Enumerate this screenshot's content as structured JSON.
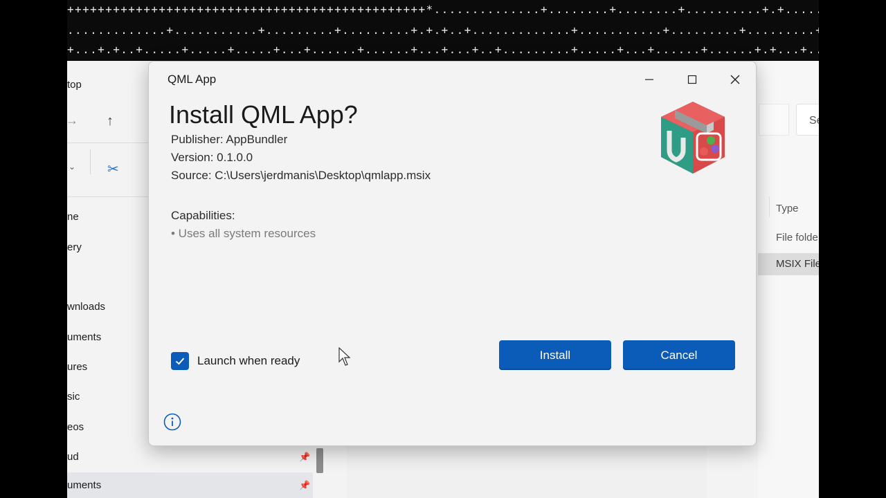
{
  "terminal": {
    "lines": [
      "+++++++++++++++++++++++++++++++++++++++++++++++*..............+........+........+..........+.+.......+.+.+..+",
      ".............+...........+.........+.........+.+.+..+.............+...........+.........+.........+...........",
      "+...+.+..+.....+.....+.....+...+......+......+...+...+..+.........+.....+...+......+......+.+...+.......+....+"
    ]
  },
  "explorer": {
    "title_fragment": "top",
    "search_fragment": "Se",
    "nav_items": [
      {
        "label": "ne",
        "pinned": false
      },
      {
        "label": "ery",
        "pinned": false
      },
      {
        "label": "wnloads",
        "pinned": false
      },
      {
        "label": "uments",
        "pinned": false
      },
      {
        "label": "ures",
        "pinned": false
      },
      {
        "label": "sic",
        "pinned": false
      },
      {
        "label": "eos",
        "pinned": false
      },
      {
        "label": "ud",
        "pinned": true
      },
      {
        "label": "uments",
        "pinned": true
      }
    ],
    "column_header": "Type",
    "rows": [
      "File folde",
      "MSIX File"
    ]
  },
  "dialog": {
    "window_title": "QML App",
    "heading": "Install QML App?",
    "publisher": "Publisher: AppBundler",
    "version": "Version: 0.1.0.0",
    "source": "Source: C:\\Users\\jerdmanis\\Desktop\\qmlapp.msix",
    "capabilities_label": "Capabilities:",
    "capabilities": [
      "• Uses all system resources"
    ],
    "launch_checkbox": {
      "label": "Launch when ready",
      "checked": true
    },
    "install_label": "Install",
    "cancel_label": "Cancel",
    "accent_color": "#0b5cb8"
  }
}
